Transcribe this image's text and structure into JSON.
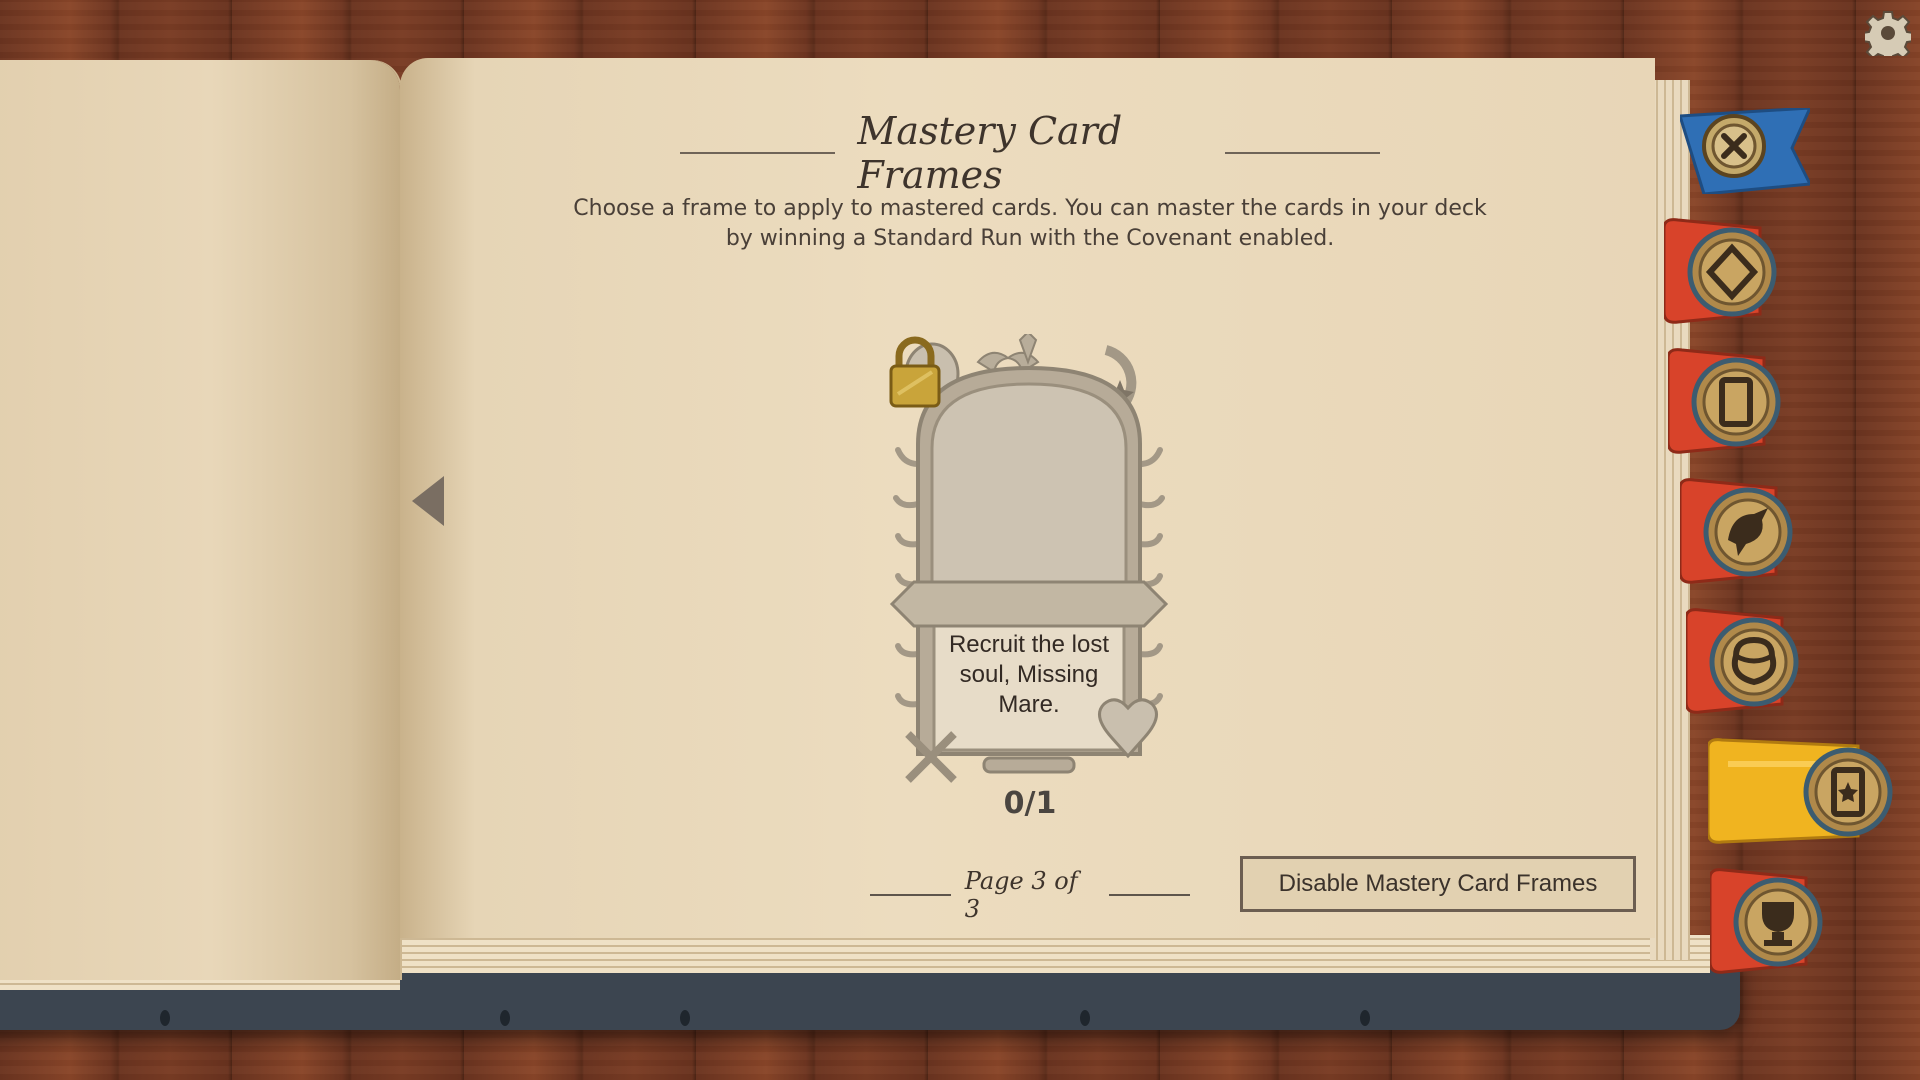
{
  "header": {
    "title": "Mastery Card Frames",
    "description": "Choose a frame to apply to mastered cards. You can master the cards in your deck by winning a Standard Run with the Covenant enabled."
  },
  "frame": {
    "requirement": "Recruit the lost soul, Missing Mare.",
    "progress_label": "0/1",
    "progress_fraction": 0.0,
    "locked": true
  },
  "pagination": {
    "label": "Page 3 of 3",
    "current": 3,
    "total": 3
  },
  "buttons": {
    "disable_label": "Disable Mastery Card Frames"
  },
  "tabs": [
    {
      "icon": "diamond-icon",
      "active": false
    },
    {
      "icon": "card-icon",
      "active": false
    },
    {
      "icon": "bird-icon",
      "active": false
    },
    {
      "icon": "pot-icon",
      "active": false
    },
    {
      "icon": "star-card-icon",
      "active": true
    },
    {
      "icon": "trophy-icon",
      "active": false
    }
  ],
  "colors": {
    "tab_inactive": "#d8432a",
    "tab_active": "#f0b420",
    "medallion": "#b0894a",
    "close_flag": "#2f6fb5"
  }
}
